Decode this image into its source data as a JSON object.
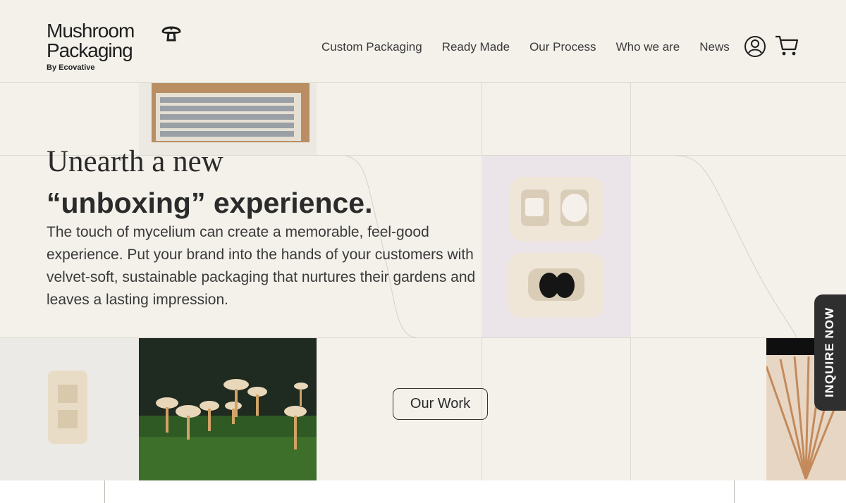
{
  "brand": {
    "line1": "Mushroom",
    "line2": "Packaging",
    "sub": "By Ecovative",
    "logo_icon": "mushroom-icon"
  },
  "nav": {
    "items": [
      {
        "label": "Custom Packaging"
      },
      {
        "label": "Ready Made"
      },
      {
        "label": "Our Process"
      },
      {
        "label": "Who we are"
      },
      {
        "label": "News"
      }
    ],
    "account_icon": "user-circle-icon",
    "cart_icon": "cart-icon"
  },
  "hero": {
    "title_line1": "Unearth a new",
    "title_line2": "“unboxing” experience.",
    "body": "The touch of mycelium can create a memorable, feel-good experience. Put your brand into the hands of your customers with velvet-soft, sustainable packaging that nurtures their gardens and leaves a lasting impression."
  },
  "cta": {
    "our_work": "Our Work",
    "inquire": "INQUIRE NOW"
  },
  "colors": {
    "background": "#f3f1ea",
    "text": "#2a2a2a",
    "dark_tab": "#2f2f2f"
  }
}
